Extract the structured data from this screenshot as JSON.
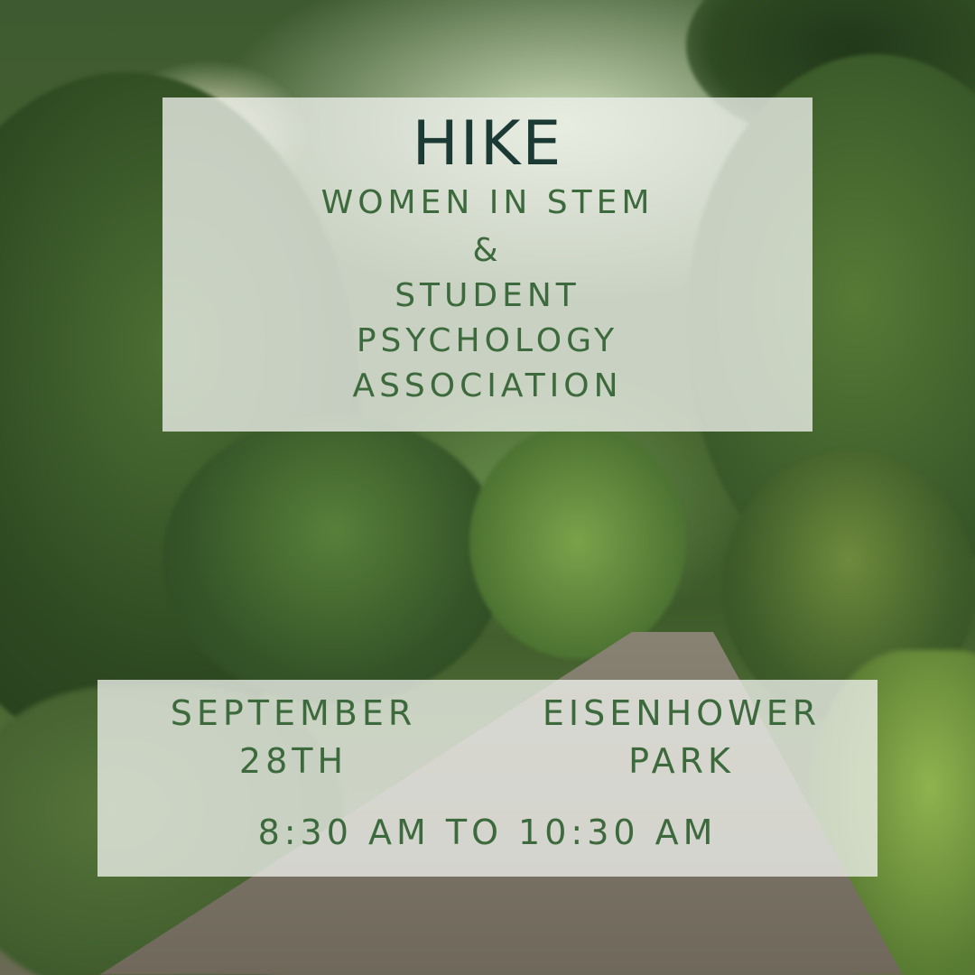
{
  "poster": {
    "title": "HIKE",
    "organizers": [
      "WOMEN IN STEM",
      "&",
      "STUDENT",
      "PSYCHOLOGY",
      "ASSOCIATION"
    ],
    "date_line1": "SEPTEMBER",
    "date_line2": "28TH",
    "location_line1": "EISENHOWER",
    "location_line2": "PARK",
    "time": "8:30 AM TO 10:30 AM"
  },
  "colors": {
    "title_text": "#1c3a34",
    "body_text": "#3d6a3c",
    "panel_background": "#eef1ec"
  }
}
